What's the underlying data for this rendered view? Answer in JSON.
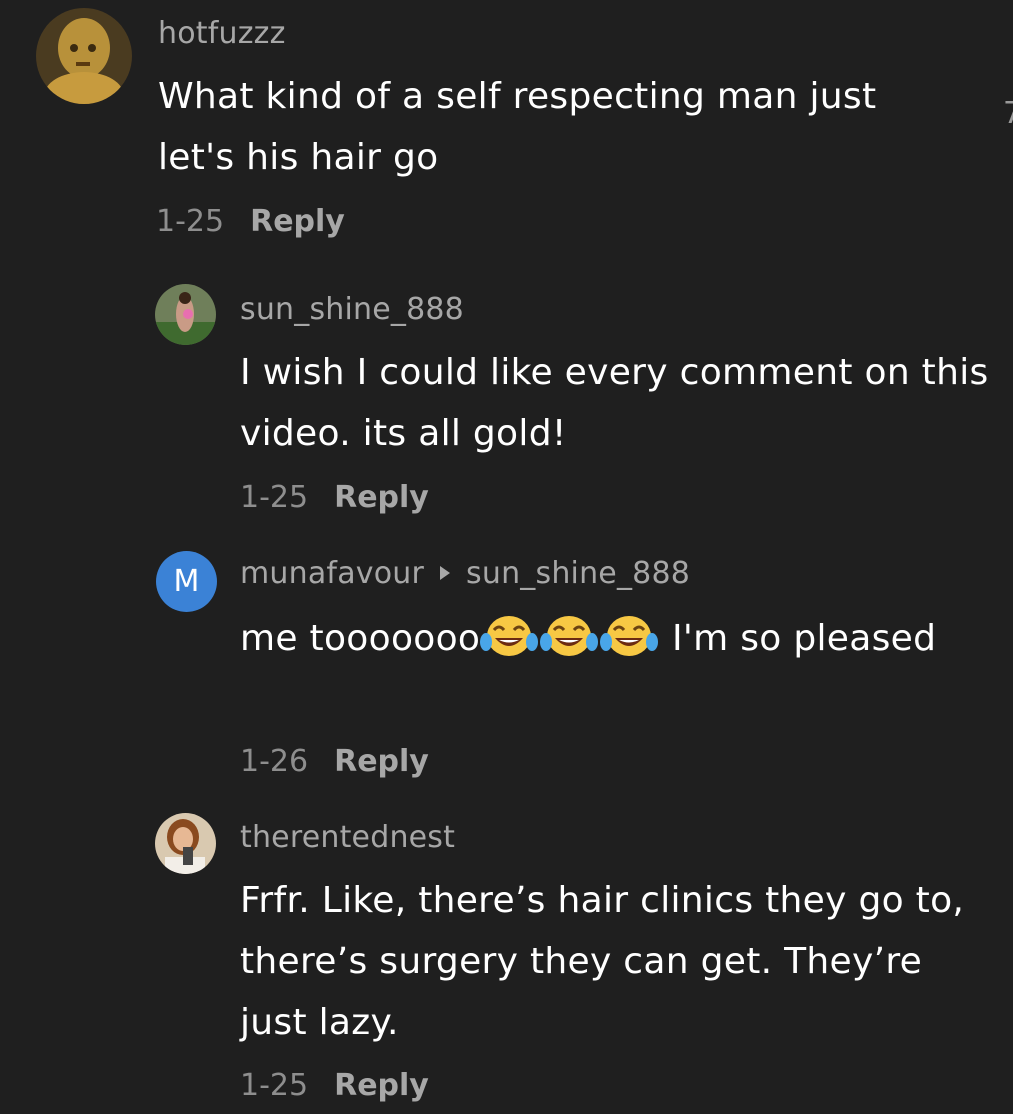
{
  "comments": [
    {
      "username": "hotfuzzz",
      "text": "What kind of a self respecting man just let's his hair go",
      "date": "1-25",
      "reply_label": "Reply"
    },
    {
      "username": "sun_shine_888",
      "text": "I wish I could like every comment on this video. its all gold!",
      "date": "1-25",
      "reply_label": "Reply"
    },
    {
      "username": "munafavour",
      "reply_to": "sun_shine_888",
      "avatar_letter": "M",
      "text_before_emoji": "me tooooooo",
      "text_after_emoji": " I'm so pleased",
      "emoji_name": "face-with-tears-of-joy-icon",
      "emoji_count": 3,
      "date": "1-26",
      "reply_label": "Reply"
    },
    {
      "username": "therentednest",
      "text": "Frfr. Like, there’s hair clinics they go to, there’s surgery they can get. They’re just lazy.",
      "date": "1-25",
      "reply_label": "Reply"
    }
  ],
  "edge_glyph": "7",
  "colors": {
    "background": "#1f1f1f",
    "username": "#a7a7a7",
    "text": "#ffffff",
    "avatar_m": "#3b82d6"
  }
}
